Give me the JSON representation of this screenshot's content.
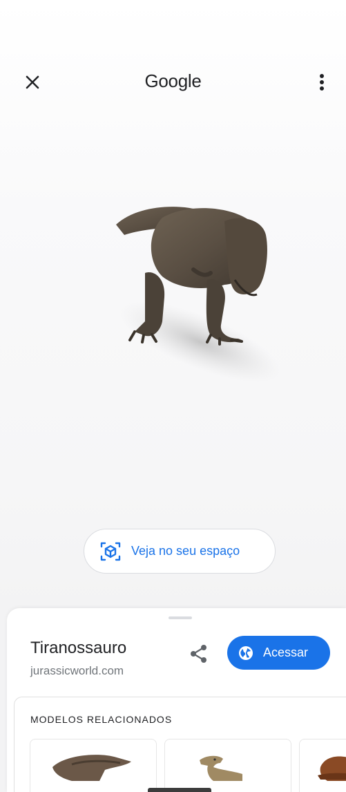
{
  "header": {
    "close_icon": "close-icon",
    "title": "Google",
    "menu_icon": "more-vert-icon"
  },
  "viewer": {
    "model_icon": "tyrannosaurus-3d-model",
    "ar_button": {
      "icon": "view-in-ar-icon",
      "label": "Veja no seu espaço"
    }
  },
  "sheet": {
    "title": "Tiranossauro",
    "domain": "jurassicworld.com",
    "share_icon": "share-icon",
    "visit_button": {
      "icon": "globe-icon",
      "label": "Acessar"
    },
    "related": {
      "heading": "MODELOS RELACIONADOS",
      "items": [
        {
          "icon": "dinosaur-model-thumbnail"
        },
        {
          "icon": "raptor-model-thumbnail"
        },
        {
          "icon": "hat-model-thumbnail"
        }
      ]
    }
  },
  "colors": {
    "accent": "#1a73e8",
    "text_primary": "#202124",
    "text_secondary": "#70757a"
  }
}
